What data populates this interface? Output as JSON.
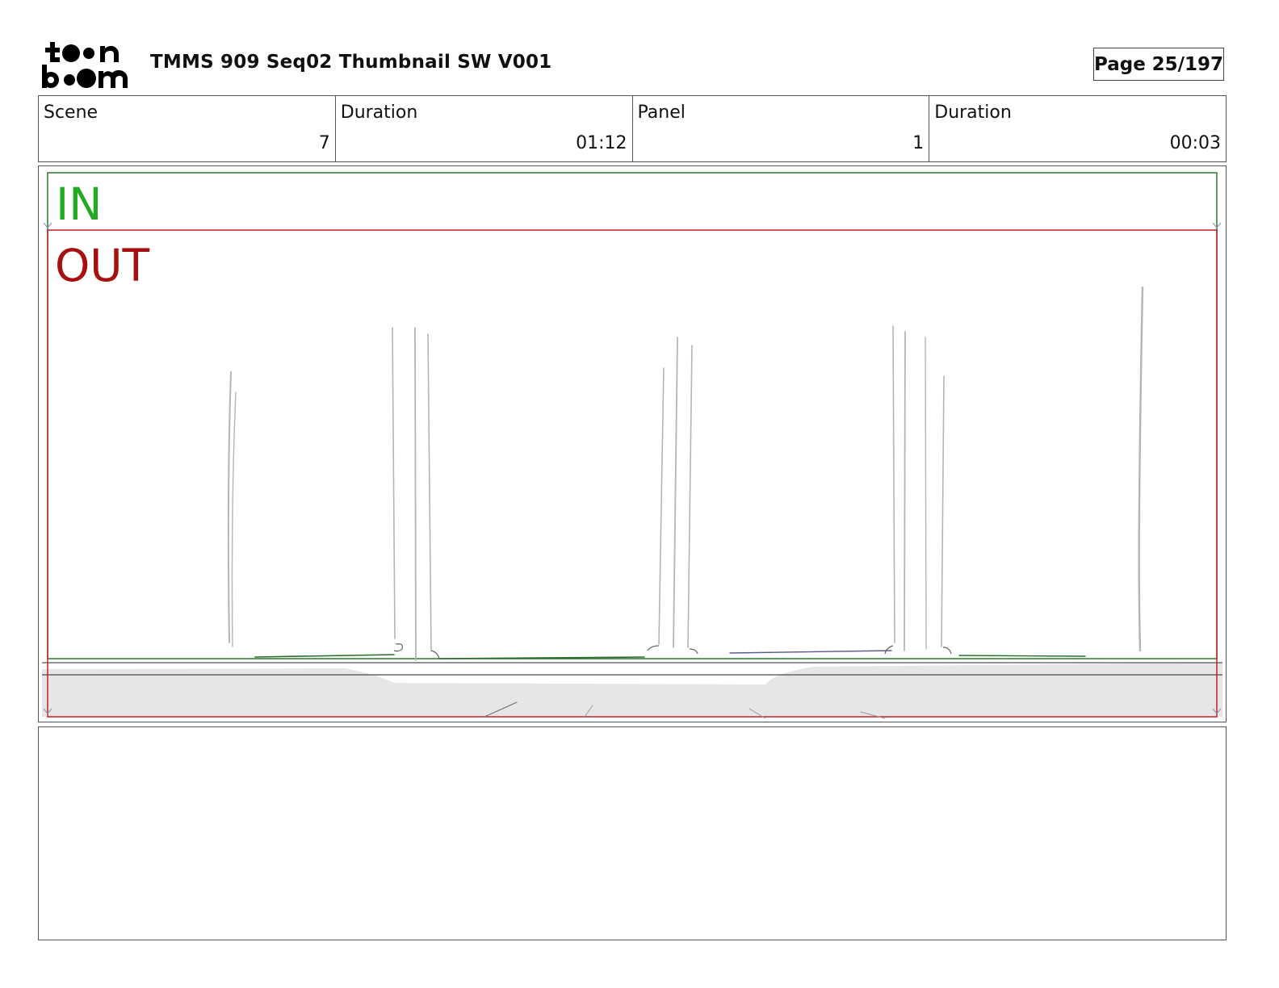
{
  "header": {
    "logo_text": "toon boom",
    "title": "TMMS 909 Seq02 Thumbnail SW V001",
    "page_label": "Page",
    "page_value": "25/197"
  },
  "info": [
    {
      "label": "Scene",
      "value": "7"
    },
    {
      "label": "Duration",
      "value": "01:12"
    },
    {
      "label": "Panel",
      "value": "1"
    },
    {
      "label": "Duration",
      "value": "00:03"
    }
  ],
  "panel": {
    "in_label": "IN",
    "out_label": "OUT",
    "colors": {
      "in": "#22aa22",
      "out": "#a80f0f",
      "sketch": "#b8b8b8",
      "ground": "#e6e6e6"
    }
  },
  "notes": {
    "text": ""
  }
}
